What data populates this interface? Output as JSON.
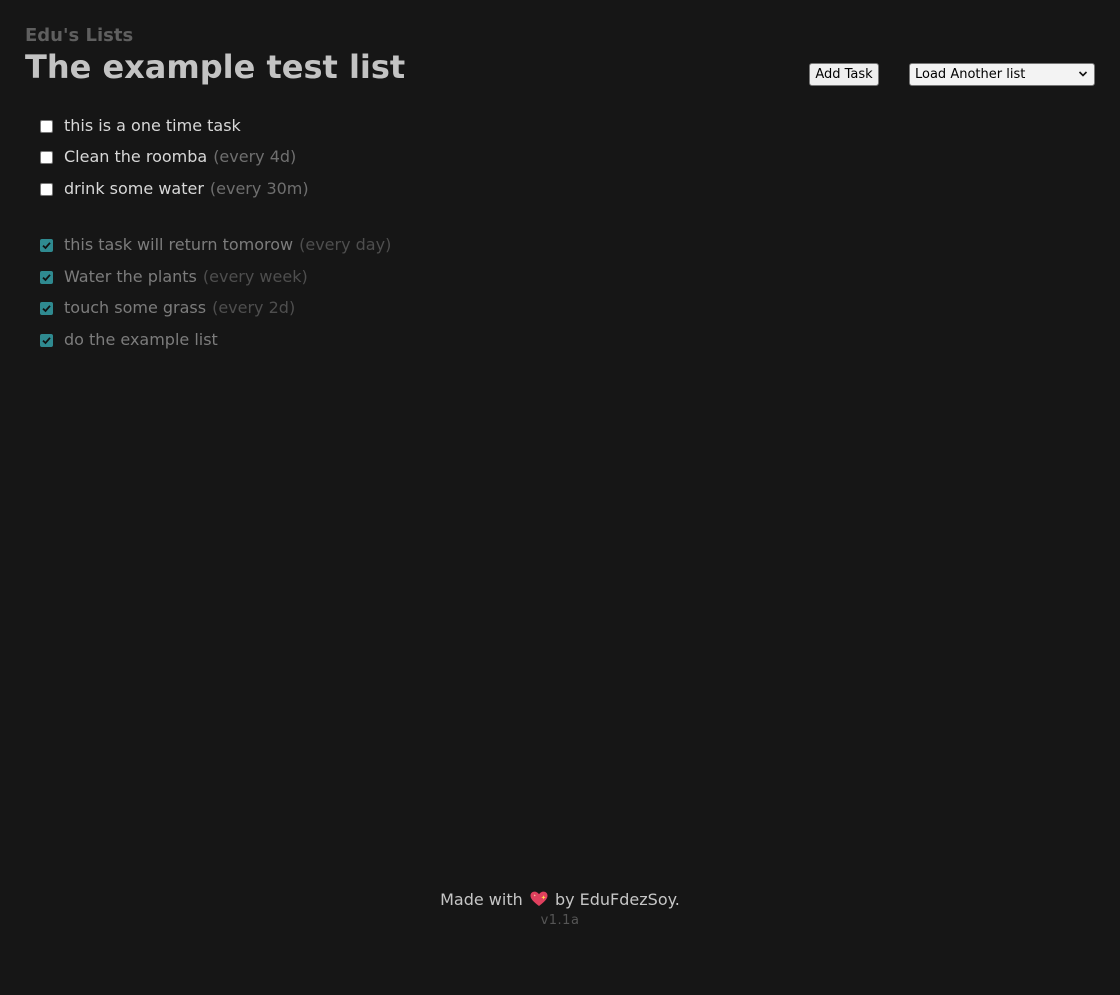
{
  "header": {
    "app_name": "Edu's Lists",
    "list_title": "The example test list",
    "add_task_label": "Add Task",
    "list_select_value": "Load Another list"
  },
  "pending_tasks": [
    {
      "name": "this is a one time task",
      "frequency": "",
      "checked": false
    },
    {
      "name": "Clean the roomba",
      "frequency": "(every 4d)",
      "checked": false
    },
    {
      "name": "drink some water",
      "frequency": "(every 30m)",
      "checked": false
    }
  ],
  "completed_tasks": [
    {
      "name": "this task will return tomorow",
      "frequency": "(every day)",
      "checked": true
    },
    {
      "name": "Water the plants",
      "frequency": "(every week)",
      "checked": true
    },
    {
      "name": "touch some grass",
      "frequency": "(every 2d)",
      "checked": true
    },
    {
      "name": "do the example list",
      "frequency": "",
      "checked": true
    }
  ],
  "footer": {
    "made_with": "Made with",
    "by_author": "by EduFdezSoy.",
    "version": "v1.1a",
    "heart_icon": "sparkling-heart-icon"
  },
  "colors": {
    "background": "#161616",
    "checkbox_checked": "#2f8a90"
  }
}
